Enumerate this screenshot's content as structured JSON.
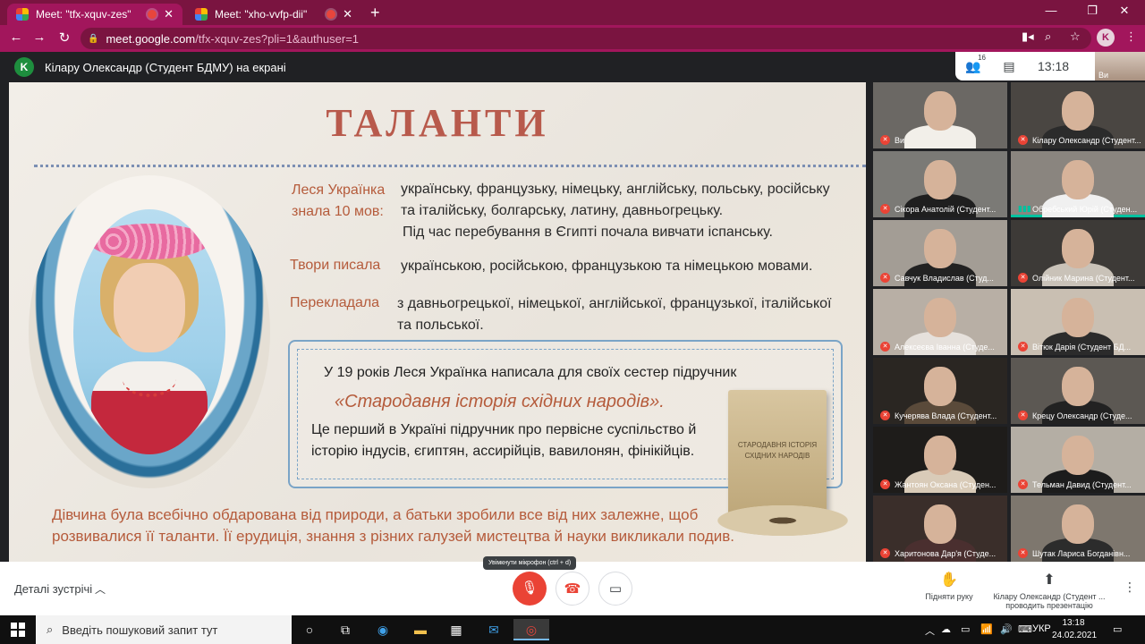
{
  "browser": {
    "tabs": [
      {
        "title": "Meet: \"tfx-xquv-zes\"",
        "active": true
      },
      {
        "title": "Meet: \"xho-vvfp-dii\"",
        "active": false
      }
    ],
    "url_host": "meet.google.com",
    "url_path": "/tfx-xquv-zes?pli=1&authuser=1",
    "profile_initial": "K",
    "accent_color": "#a2165c"
  },
  "meet": {
    "presenter_initial": "K",
    "presenter_title": "Кілару Олександр (Студент БДМУ) на екрані",
    "participant_count": "16",
    "clock": "13:18",
    "self_label": "Ви",
    "participants": [
      {
        "name": "Ви",
        "muted": true
      },
      {
        "name": "Кілару Олександр (Студент...",
        "muted": true
      },
      {
        "name": "Сікора Анатолій (Студент...",
        "muted": true
      },
      {
        "name": "Обребський Юрій (Студен...",
        "muted": false
      },
      {
        "name": "Савчук Владислав (Студ...",
        "muted": true
      },
      {
        "name": "Олійник Марина (Студент...",
        "muted": true
      },
      {
        "name": "Алексеєва Іванна (Студе...",
        "muted": true
      },
      {
        "name": "Вітюк Дарія (Студент БД...",
        "muted": true
      },
      {
        "name": "Кучерява Влада (Студент...",
        "muted": true
      },
      {
        "name": "Крецу Олександр (Студе...",
        "muted": true
      },
      {
        "name": "Жантоян Оксана (Студен...",
        "muted": true
      },
      {
        "name": "Тельман Давид (Студент...",
        "muted": true
      },
      {
        "name": "Харитонова Дар'я (Студе...",
        "muted": true
      },
      {
        "name": "Шутак Лариса Богданівн...",
        "muted": true
      }
    ],
    "details_label": "Деталі зустрічі",
    "mic_tooltip": "Увімкнути мікрофон (ctrl + d)",
    "raise_hand": "Підняти руку",
    "presenting_line1": "Кілару Олександр (Студент ...",
    "presenting_line2": "проводить презентацію"
  },
  "slide": {
    "title": "ТАЛАНТИ",
    "label1a": "Леся Українка",
    "label1b": "знала 10 мов:",
    "text1a": "українську, французьку, німецьку, англійську, польську, російську",
    "text1b": "та італійську, болгарську, латину, давньогрецьку.",
    "text1c": "Під час перебування в Єгипті почала вивчати іспанську.",
    "label2": "Твори писала",
    "text2": "українською, російською, французькою та німецькою мовами.",
    "label3": "Перекладала",
    "text3a": "з давньогрецької, німецької, англійської, французької, італійської",
    "text3b": "та польської.",
    "box1": "У 19 років Леся Українка  написала  для своїх сестер підручник",
    "box2": "«Стародавня  історія  східних  народів».",
    "box3": "Це перший в Україні підручник про первісне суспільство й",
    "box4": "історію індусів, єгиптян, ассирійців, вавилонян, фінікійців.",
    "book_text": "СТАРОДАВНЯ ІСТОРІЯ СХІДНИХ НАРОДІВ",
    "bottom1": "Дівчина була всебічно обдарована від природи, а батьки зробили все від них залежне, щоб",
    "bottom2": "розвивалися її таланти. Її ерудиція, знання з різних галузей мистецтва й науки викликали подив."
  },
  "taskbar": {
    "search_placeholder": "Введіть пошуковий запит тут",
    "lang": "УКР",
    "time": "13:18",
    "date": "24.02.2021"
  }
}
